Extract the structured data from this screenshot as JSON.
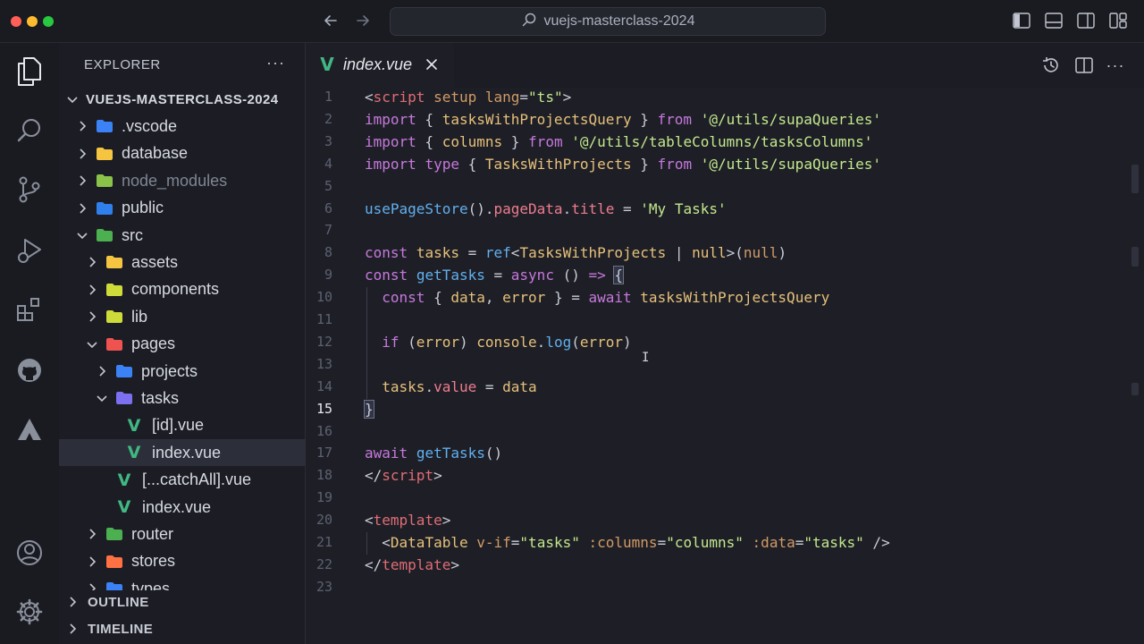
{
  "window": {
    "search_text": "vuejs-masterclass-2024"
  },
  "activity_bar": {
    "items": [
      "explorer-icon",
      "search-icon",
      "source-control-icon",
      "run-debug-icon",
      "extensions-icon",
      "github-icon",
      "deploy-icon"
    ],
    "bottom": [
      "account-icon",
      "settings-icon"
    ]
  },
  "sidebar": {
    "header": "EXPLORER",
    "more": "···",
    "tree": [
      {
        "label": "VUEJS-MASTERCLASS-2024",
        "depth": 0,
        "type": "root",
        "open": true
      },
      {
        "label": ".vscode",
        "depth": 1,
        "type": "folder",
        "icon_color": "#3b82f6"
      },
      {
        "label": "database",
        "depth": 1,
        "type": "folder",
        "icon_color": "#f5c542"
      },
      {
        "label": "node_modules",
        "depth": 1,
        "type": "folder",
        "icon_color": "#8bc34a",
        "dim": true
      },
      {
        "label": "public",
        "depth": 1,
        "type": "folder",
        "icon_color": "#2f80ed"
      },
      {
        "label": "src",
        "depth": 1,
        "type": "folder",
        "icon_color": "#4caf50",
        "open": true
      },
      {
        "label": "assets",
        "depth": 2,
        "type": "folder",
        "icon_color": "#f5c542"
      },
      {
        "label": "components",
        "depth": 2,
        "type": "folder",
        "icon_color": "#cddc39"
      },
      {
        "label": "lib",
        "depth": 2,
        "type": "folder",
        "icon_color": "#cddc39"
      },
      {
        "label": "pages",
        "depth": 2,
        "type": "folder",
        "icon_color": "#ef5350",
        "open": true
      },
      {
        "label": "projects",
        "depth": 3,
        "type": "folder",
        "icon_color": "#3b82f6"
      },
      {
        "label": "tasks",
        "depth": 3,
        "type": "folder",
        "icon_color": "#7c6ff0",
        "open": true
      },
      {
        "label": "[id].vue",
        "depth": 4,
        "type": "vue"
      },
      {
        "label": "index.vue",
        "depth": 4,
        "type": "vue",
        "selected": true
      },
      {
        "label": "[...catchAll].vue",
        "depth": 3,
        "type": "vue"
      },
      {
        "label": "index.vue",
        "depth": 3,
        "type": "vue"
      },
      {
        "label": "router",
        "depth": 2,
        "type": "folder",
        "icon_color": "#4caf50"
      },
      {
        "label": "stores",
        "depth": 2,
        "type": "folder",
        "icon_color": "#ff7043"
      },
      {
        "label": "types",
        "depth": 2,
        "type": "folder",
        "icon_color": "#3b82f6"
      }
    ],
    "sections": [
      "OUTLINE",
      "TIMELINE"
    ]
  },
  "editor": {
    "tab": {
      "label": "index.vue"
    },
    "active_line": 15,
    "lines": [
      [
        [
          "pl",
          "<"
        ],
        [
          "tag",
          "script"
        ],
        [
          "attr",
          " setup"
        ],
        [
          "attr",
          " lang"
        ],
        [
          "pl",
          "="
        ],
        [
          "str",
          "\"ts\""
        ],
        [
          "pl",
          ">"
        ]
      ],
      [
        [
          "kw",
          "import"
        ],
        [
          "pl",
          " { "
        ],
        [
          "typ",
          "tasksWithProjectsQuery"
        ],
        [
          "pl",
          " } "
        ],
        [
          "kw",
          "from"
        ],
        [
          "pl",
          " "
        ],
        [
          "str",
          "'@/utils/supaQueries'"
        ]
      ],
      [
        [
          "kw",
          "import"
        ],
        [
          "pl",
          " { "
        ],
        [
          "typ",
          "columns"
        ],
        [
          "pl",
          " } "
        ],
        [
          "kw",
          "from"
        ],
        [
          "pl",
          " "
        ],
        [
          "str",
          "'@/utils/tableColumns/tasksColumns'"
        ]
      ],
      [
        [
          "kw",
          "import"
        ],
        [
          "pl",
          " "
        ],
        [
          "kw",
          "type"
        ],
        [
          "pl",
          " { "
        ],
        [
          "typ",
          "TasksWithProjects"
        ],
        [
          "pl",
          " } "
        ],
        [
          "kw",
          "from"
        ],
        [
          "pl",
          " "
        ],
        [
          "str",
          "'@/utils/supaQueries'"
        ]
      ],
      [],
      [
        [
          "fn",
          "usePageStore"
        ],
        [
          "pl",
          "()."
        ],
        [
          "prop",
          "pageData"
        ],
        [
          "pl",
          "."
        ],
        [
          "prop",
          "title"
        ],
        [
          "pl",
          " = "
        ],
        [
          "str",
          "'My Tasks'"
        ]
      ],
      [],
      [
        [
          "kw",
          "const"
        ],
        [
          "pl",
          " "
        ],
        [
          "typ",
          "tasks"
        ],
        [
          "pl",
          " = "
        ],
        [
          "fn",
          "ref"
        ],
        [
          "pl",
          "<"
        ],
        [
          "typ",
          "TasksWithProjects"
        ],
        [
          "pl",
          " | "
        ],
        [
          "typ",
          "null"
        ],
        [
          "pl",
          ">("
        ],
        [
          "nul",
          "null"
        ],
        [
          "pl",
          ")"
        ]
      ],
      [
        [
          "kw",
          "const"
        ],
        [
          "pl",
          " "
        ],
        [
          "fn",
          "getTasks"
        ],
        [
          "pl",
          " = "
        ],
        [
          "kw",
          "async"
        ],
        [
          "pl",
          " () "
        ],
        [
          "kw",
          "=>"
        ],
        [
          "pl",
          " "
        ],
        [
          "brk",
          "{"
        ]
      ],
      [
        [
          "pl",
          "  "
        ],
        [
          "kw",
          "const"
        ],
        [
          "pl",
          " { "
        ],
        [
          "typ",
          "data"
        ],
        [
          "pl",
          ", "
        ],
        [
          "typ",
          "error"
        ],
        [
          "pl",
          " } = "
        ],
        [
          "kw",
          "await"
        ],
        [
          "pl",
          " "
        ],
        [
          "typ",
          "tasksWithProjectsQuery"
        ]
      ],
      [],
      [
        [
          "pl",
          "  "
        ],
        [
          "kw",
          "if"
        ],
        [
          "pl",
          " ("
        ],
        [
          "typ",
          "error"
        ],
        [
          "pl",
          ") "
        ],
        [
          "typ",
          "console"
        ],
        [
          "pl",
          "."
        ],
        [
          "fn",
          "log"
        ],
        [
          "pl",
          "("
        ],
        [
          "typ",
          "error"
        ],
        [
          "pl",
          ")"
        ]
      ],
      [],
      [
        [
          "pl",
          "  "
        ],
        [
          "typ",
          "tasks"
        ],
        [
          "pl",
          "."
        ],
        [
          "prop",
          "value"
        ],
        [
          "pl",
          " = "
        ],
        [
          "typ",
          "data"
        ]
      ],
      [
        [
          "brk",
          "}"
        ]
      ],
      [],
      [
        [
          "kw",
          "await"
        ],
        [
          "pl",
          " "
        ],
        [
          "fn",
          "getTasks"
        ],
        [
          "pl",
          "()"
        ]
      ],
      [
        [
          "pl",
          "</"
        ],
        [
          "tag",
          "script"
        ],
        [
          "pl",
          ">"
        ]
      ],
      [],
      [
        [
          "pl",
          "<"
        ],
        [
          "tag",
          "template"
        ],
        [
          "pl",
          ">"
        ]
      ],
      [
        [
          "pl",
          "  <"
        ],
        [
          "typ",
          "DataTable"
        ],
        [
          "pl",
          " "
        ],
        [
          "attr",
          "v-if"
        ],
        [
          "pl",
          "="
        ],
        [
          "str",
          "\"tasks\""
        ],
        [
          "pl",
          " "
        ],
        [
          "attr",
          ":columns"
        ],
        [
          "pl",
          "="
        ],
        [
          "str",
          "\"columns\""
        ],
        [
          "pl",
          " "
        ],
        [
          "attr",
          ":data"
        ],
        [
          "pl",
          "="
        ],
        [
          "str",
          "\"tasks\""
        ],
        [
          "pl",
          " />"
        ]
      ],
      [
        [
          "pl",
          "</"
        ],
        [
          "tag",
          "template"
        ],
        [
          "pl",
          ">"
        ]
      ],
      []
    ]
  }
}
